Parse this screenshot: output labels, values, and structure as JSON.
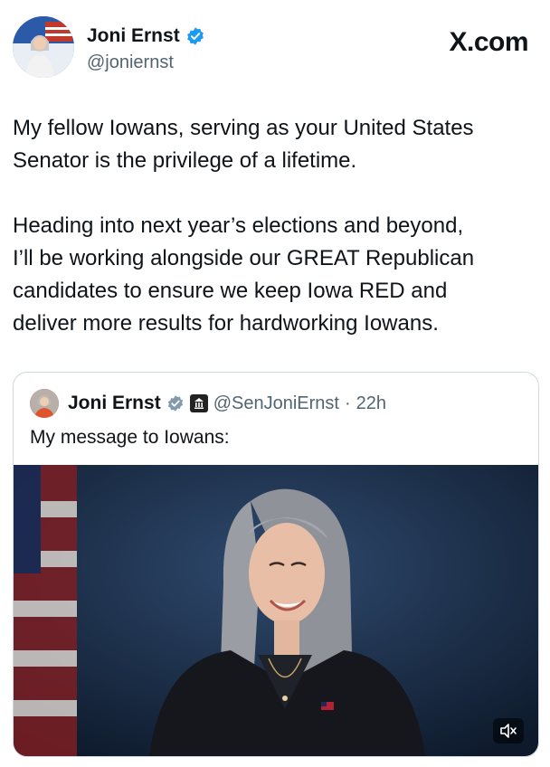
{
  "author": {
    "name": "Joni Ernst",
    "handle": "@joniernst"
  },
  "watermark": "X.com",
  "tweet": {
    "text": "My fellow Iowans, serving as your United States\nSenator is the privilege of a lifetime.\n\nHeading into next year’s elections and beyond,\nI’ll be working alongside our GREAT Republican\ncandidates to ensure we keep Iowa RED and\ndeliver more results for hardworking Iowans."
  },
  "quoted_tweet": {
    "name": "Joni Ernst",
    "handle": "@SenJoniErnst",
    "separator": "·",
    "time": "22h",
    "text": "My message to Iowans:"
  },
  "colors": {
    "verified_blue": "#1d9bf0",
    "verified_gray": "#829aab",
    "text": "#0f1419",
    "secondary_text": "#536471"
  },
  "icons": {
    "verified": "verified-badge-icon",
    "gov": "government-badge-icon",
    "mute": "mute-icon"
  }
}
